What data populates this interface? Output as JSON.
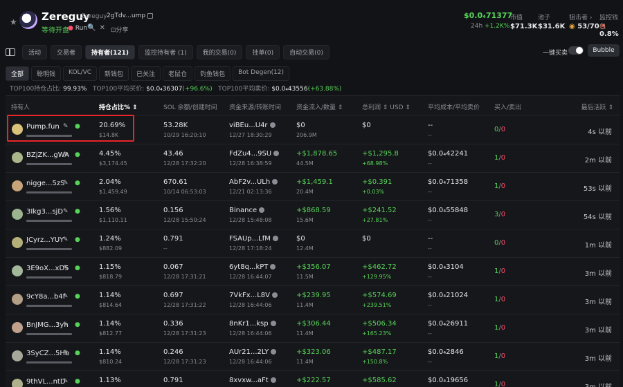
{
  "header": {
    "name": "Zereguy",
    "name_sub": "Zereguy",
    "address": "2gTdv...ump",
    "status": "等待开盘",
    "run": "Run",
    "socials": "🔍 ✕",
    "share": "⊡分享",
    "price": "$0.0₄7 1377",
    "price_display": "$0.0₄71377",
    "change_label": "24h",
    "change_value": "+1.2K%",
    "stats": [
      {
        "label": "市值",
        "value": "$71.3K"
      },
      {
        "label": "池子",
        "value": "$31.6K"
      },
      {
        "label": "狙击者 ›",
        "value": "53/70"
      },
      {
        "label": "监控钱包",
        "value": "0.8%"
      }
    ]
  },
  "tabs": {
    "items": [
      "活动",
      "交易者",
      "持有者(121)",
      "监控持有者 (1)",
      "我的交易(0)",
      "挂单(0)",
      "自动交易(0)"
    ],
    "active_index": 2,
    "toggle_label": "一键买卖",
    "bubble_label": "Bubble"
  },
  "filters": {
    "items": [
      "全部",
      "聪明钱",
      "KOL/VC",
      "新钱包",
      "已关注",
      "老鼠仓",
      "钓鱼钱包",
      "Bot Degen(12)"
    ],
    "active_index": 0
  },
  "top100": {
    "label1": "TOP100持仓占比:",
    "value1": "99.93%",
    "label2": "TOP100平均买价:",
    "value2": "$0.0₄36307",
    "change2": "(+96.6%)",
    "label3": "TOP100平均卖价:",
    "value3": "$0.0₄43556",
    "change3": "(+63.88%)"
  },
  "columns": [
    "持有人",
    "持仓占比% ⇕",
    "SOL 余额/创建时间",
    "资金来源/转账时间",
    "资金流入/数量 ⇕",
    "总利润 ⇕ USD ⇕",
    "平均成本/平均卖价",
    "买入/卖出",
    "最后活跃 ⇕"
  ],
  "rows": [
    {
      "holder": "Pump.fun",
      "pct": "20.69%",
      "usd": "$14.8K",
      "sol": "53.28K",
      "created": "10/29 16:20:10",
      "source": "viBEu...U4r",
      "src_time": "12/27 18:30:29",
      "inflow": "$0",
      "qty": "206.9M",
      "profit": "$0",
      "profit_pct": "",
      "cost": "--",
      "sell": "--",
      "buys": "0",
      "sells": "0",
      "active": "4s 以前",
      "avatar_color": "#d9c27a",
      "inflow_pos": false,
      "profit_pos": false
    },
    {
      "holder": "BZjZK...gWA",
      "pct": "4.45%",
      "usd": "$3,174.45",
      "sol": "43.46",
      "created": "12/28 17:32:20",
      "source": "FdZu4...9SU",
      "src_time": "12/28 16:38:59",
      "inflow": "+$1,878.65",
      "qty": "44.5M",
      "profit": "+$1,295.8",
      "profit_pct": "+68.98%",
      "cost": "$0.0₄42241",
      "sell": "--",
      "buys": "1",
      "sells": "0",
      "active": "2m 以前",
      "avatar_color": "#a9b58a",
      "inflow_pos": true,
      "profit_pos": true
    },
    {
      "holder": "nigge...5zS",
      "pct": "2.04%",
      "usd": "$1,459.49",
      "sol": "670.61",
      "created": "10/14 06:53:03",
      "source": "AbF2v...ULh",
      "src_time": "12/21 02:13:36",
      "inflow": "+$1,459.1",
      "qty": "20.4M",
      "profit": "+$0.391",
      "profit_pct": "+0.03%",
      "cost": "$0.0₄71358",
      "sell": "--",
      "buys": "1",
      "sells": "0",
      "active": "53s 以前",
      "avatar_color": "#c7a47a",
      "inflow_pos": true,
      "profit_pos": true
    },
    {
      "holder": "3Ikg3...sjD",
      "pct": "1.56%",
      "usd": "$1,110.11",
      "sol": "0.156",
      "created": "12/28 15:50:24",
      "source": "Binance",
      "src_time": "12/28 15:48:08",
      "inflow": "+$868.59",
      "qty": "15.6M",
      "profit": "+$241.52",
      "profit_pct": "+27.81%",
      "cost": "$0.0₄55848",
      "sell": "--",
      "buys": "3",
      "sells": "0",
      "active": "54s 以前",
      "avatar_color": "#9bb38f",
      "inflow_pos": true,
      "profit_pos": true
    },
    {
      "holder": "JCyrz...YUY",
      "pct": "1.24%",
      "usd": "$882.09",
      "sol": "0.791",
      "created": "--",
      "source": "FSAUp...LfM",
      "src_time": "12/28 17:18:24",
      "inflow": "$0",
      "qty": "12.4M",
      "profit": "$0",
      "profit_pct": "",
      "cost": "--",
      "sell": "--",
      "buys": "0",
      "sells": "0",
      "active": "1m 以前",
      "avatar_color": "#b5b07a",
      "inflow_pos": false,
      "profit_pos": false
    },
    {
      "holder": "3E9oX...xD5",
      "pct": "1.15%",
      "usd": "$818.79",
      "sol": "0.067",
      "created": "12/28 17:31:21",
      "source": "6yt8q...kPT",
      "src_time": "12/28 16:44:07",
      "inflow": "+$356.07",
      "qty": "11.5M",
      "profit": "+$462.72",
      "profit_pct": "+129.95%",
      "cost": "$0.0₄3104",
      "sell": "--",
      "buys": "1",
      "sells": "0",
      "active": "3m 以前",
      "avatar_color": "#a3b89a",
      "inflow_pos": true,
      "profit_pos": true
    },
    {
      "holder": "9cY8a...b4f",
      "pct": "1.14%",
      "usd": "$814.64",
      "sol": "0.697",
      "created": "12/28 17:31:22",
      "source": "7VkFx...L8V",
      "src_time": "12/28 16:44:06",
      "inflow": "+$239.95",
      "qty": "11.4M",
      "profit": "+$574.69",
      "profit_pct": "+239.51%",
      "cost": "$0.0₄21024",
      "sell": "--",
      "buys": "1",
      "sells": "0",
      "active": "3m 以前",
      "avatar_color": "#b39e86",
      "inflow_pos": true,
      "profit_pos": true
    },
    {
      "holder": "BnJMG...3yn",
      "pct": "1.14%",
      "usd": "$812.77",
      "sol": "0.336",
      "created": "12/28 17:31:23",
      "source": "8nKr1...ksp",
      "src_time": "12/28 16:44:06",
      "inflow": "+$306.44",
      "qty": "11.4M",
      "profit": "+$506.34",
      "profit_pct": "+165.23%",
      "cost": "$0.0₄26911",
      "sell": "--",
      "buys": "1",
      "sells": "0",
      "active": "3m 以前",
      "avatar_color": "#c0a08b",
      "inflow_pos": true,
      "profit_pos": true
    },
    {
      "holder": "3SyCZ...5Hb",
      "pct": "1.14%",
      "usd": "$810.24",
      "sol": "0.246",
      "created": "12/28 17:31:23",
      "source": "AUr21...2LY",
      "src_time": "12/28 16:44:06",
      "inflow": "+$323.06",
      "qty": "11.4M",
      "profit": "+$487.17",
      "profit_pct": "+150.8%",
      "cost": "$0.0₄2846",
      "sell": "--",
      "buys": "1",
      "sells": "0",
      "active": "3m 以前",
      "avatar_color": "#a8a89a",
      "inflow_pos": true,
      "profit_pos": true
    },
    {
      "holder": "9thVL...ntD",
      "pct": "1.13%",
      "usd": "$808.19",
      "sol": "0.791",
      "created": "12/28 17:31:22",
      "source": "8xvxw...aFt",
      "src_time": "12/28 16:44:06",
      "inflow": "+$222.57",
      "qty": "11.3M",
      "profit": "+$585.62",
      "profit_pct": "+263.12%",
      "cost": "$0.0₄19656",
      "sell": "--",
      "buys": "1",
      "sells": "0",
      "active": "3m 以前",
      "avatar_color": "#b0b18a",
      "inflow_pos": true,
      "profit_pos": true
    }
  ]
}
